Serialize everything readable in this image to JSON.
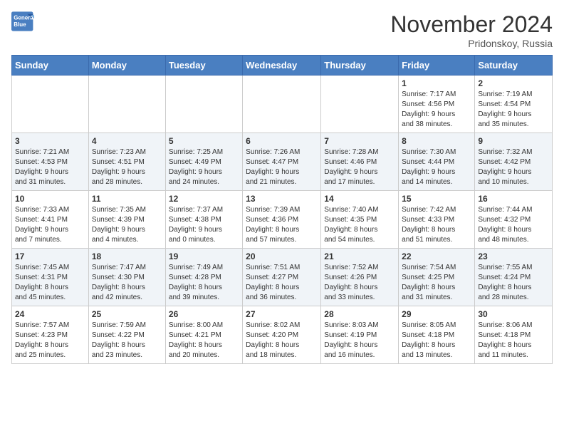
{
  "header": {
    "logo_line1": "General",
    "logo_line2": "Blue",
    "month_title": "November 2024",
    "location": "Pridonskoy, Russia"
  },
  "days_of_week": [
    "Sunday",
    "Monday",
    "Tuesday",
    "Wednesday",
    "Thursday",
    "Friday",
    "Saturday"
  ],
  "weeks": [
    [
      {
        "day": "",
        "info": ""
      },
      {
        "day": "",
        "info": ""
      },
      {
        "day": "",
        "info": ""
      },
      {
        "day": "",
        "info": ""
      },
      {
        "day": "",
        "info": ""
      },
      {
        "day": "1",
        "info": "Sunrise: 7:17 AM\nSunset: 4:56 PM\nDaylight: 9 hours\nand 38 minutes."
      },
      {
        "day": "2",
        "info": "Sunrise: 7:19 AM\nSunset: 4:54 PM\nDaylight: 9 hours\nand 35 minutes."
      }
    ],
    [
      {
        "day": "3",
        "info": "Sunrise: 7:21 AM\nSunset: 4:53 PM\nDaylight: 9 hours\nand 31 minutes."
      },
      {
        "day": "4",
        "info": "Sunrise: 7:23 AM\nSunset: 4:51 PM\nDaylight: 9 hours\nand 28 minutes."
      },
      {
        "day": "5",
        "info": "Sunrise: 7:25 AM\nSunset: 4:49 PM\nDaylight: 9 hours\nand 24 minutes."
      },
      {
        "day": "6",
        "info": "Sunrise: 7:26 AM\nSunset: 4:47 PM\nDaylight: 9 hours\nand 21 minutes."
      },
      {
        "day": "7",
        "info": "Sunrise: 7:28 AM\nSunset: 4:46 PM\nDaylight: 9 hours\nand 17 minutes."
      },
      {
        "day": "8",
        "info": "Sunrise: 7:30 AM\nSunset: 4:44 PM\nDaylight: 9 hours\nand 14 minutes."
      },
      {
        "day": "9",
        "info": "Sunrise: 7:32 AM\nSunset: 4:42 PM\nDaylight: 9 hours\nand 10 minutes."
      }
    ],
    [
      {
        "day": "10",
        "info": "Sunrise: 7:33 AM\nSunset: 4:41 PM\nDaylight: 9 hours\nand 7 minutes."
      },
      {
        "day": "11",
        "info": "Sunrise: 7:35 AM\nSunset: 4:39 PM\nDaylight: 9 hours\nand 4 minutes."
      },
      {
        "day": "12",
        "info": "Sunrise: 7:37 AM\nSunset: 4:38 PM\nDaylight: 9 hours\nand 0 minutes."
      },
      {
        "day": "13",
        "info": "Sunrise: 7:39 AM\nSunset: 4:36 PM\nDaylight: 8 hours\nand 57 minutes."
      },
      {
        "day": "14",
        "info": "Sunrise: 7:40 AM\nSunset: 4:35 PM\nDaylight: 8 hours\nand 54 minutes."
      },
      {
        "day": "15",
        "info": "Sunrise: 7:42 AM\nSunset: 4:33 PM\nDaylight: 8 hours\nand 51 minutes."
      },
      {
        "day": "16",
        "info": "Sunrise: 7:44 AM\nSunset: 4:32 PM\nDaylight: 8 hours\nand 48 minutes."
      }
    ],
    [
      {
        "day": "17",
        "info": "Sunrise: 7:45 AM\nSunset: 4:31 PM\nDaylight: 8 hours\nand 45 minutes."
      },
      {
        "day": "18",
        "info": "Sunrise: 7:47 AM\nSunset: 4:30 PM\nDaylight: 8 hours\nand 42 minutes."
      },
      {
        "day": "19",
        "info": "Sunrise: 7:49 AM\nSunset: 4:28 PM\nDaylight: 8 hours\nand 39 minutes."
      },
      {
        "day": "20",
        "info": "Sunrise: 7:51 AM\nSunset: 4:27 PM\nDaylight: 8 hours\nand 36 minutes."
      },
      {
        "day": "21",
        "info": "Sunrise: 7:52 AM\nSunset: 4:26 PM\nDaylight: 8 hours\nand 33 minutes."
      },
      {
        "day": "22",
        "info": "Sunrise: 7:54 AM\nSunset: 4:25 PM\nDaylight: 8 hours\nand 31 minutes."
      },
      {
        "day": "23",
        "info": "Sunrise: 7:55 AM\nSunset: 4:24 PM\nDaylight: 8 hours\nand 28 minutes."
      }
    ],
    [
      {
        "day": "24",
        "info": "Sunrise: 7:57 AM\nSunset: 4:23 PM\nDaylight: 8 hours\nand 25 minutes."
      },
      {
        "day": "25",
        "info": "Sunrise: 7:59 AM\nSunset: 4:22 PM\nDaylight: 8 hours\nand 23 minutes."
      },
      {
        "day": "26",
        "info": "Sunrise: 8:00 AM\nSunset: 4:21 PM\nDaylight: 8 hours\nand 20 minutes."
      },
      {
        "day": "27",
        "info": "Sunrise: 8:02 AM\nSunset: 4:20 PM\nDaylight: 8 hours\nand 18 minutes."
      },
      {
        "day": "28",
        "info": "Sunrise: 8:03 AM\nSunset: 4:19 PM\nDaylight: 8 hours\nand 16 minutes."
      },
      {
        "day": "29",
        "info": "Sunrise: 8:05 AM\nSunset: 4:18 PM\nDaylight: 8 hours\nand 13 minutes."
      },
      {
        "day": "30",
        "info": "Sunrise: 8:06 AM\nSunset: 4:18 PM\nDaylight: 8 hours\nand 11 minutes."
      }
    ]
  ]
}
